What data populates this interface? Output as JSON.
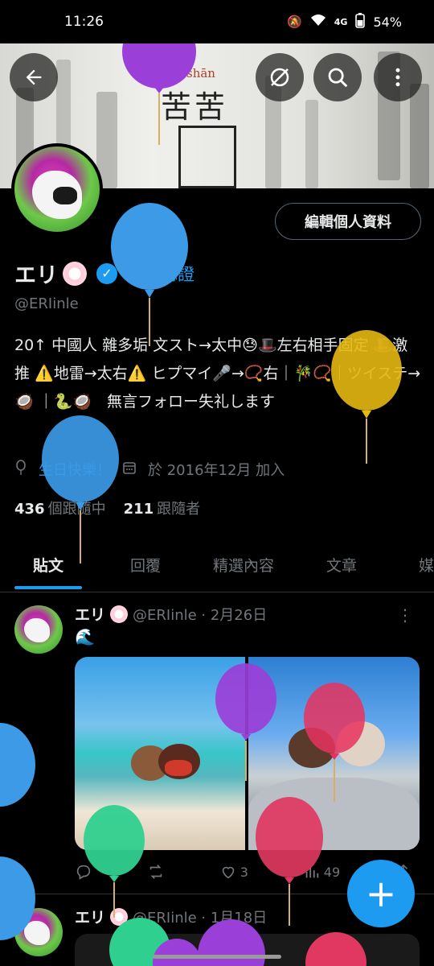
{
  "status": {
    "time": "11:26",
    "battery": "54%",
    "network": "4G"
  },
  "profile": {
    "name": "エリ",
    "verified_label": "獲得認證",
    "handle": "@ERIinle",
    "edit_label": "編輯個人資料",
    "bio": "20↑ 中國人 雜多垢 文スト→太中😓🎩左右相手固定 🎩激推 ⚠️地雷→太右⚠️ ヒプマイ🎤→📿右｜🎋📿｜ツイステ→ 🥥 ｜🐍🥥　無言フォロー失礼します",
    "birthday": "生日快樂！",
    "joined": "於 2016年12月 加入",
    "following_count": "436",
    "following_label": "個跟隨中",
    "followers_count": "211",
    "followers_label": "跟隨者"
  },
  "banner": {
    "pinyin": "shān",
    "chars": "苦苦"
  },
  "tabs": [
    {
      "label": "貼文",
      "active": true
    },
    {
      "label": "回覆",
      "active": false
    },
    {
      "label": "精選內容",
      "active": false
    },
    {
      "label": "文章",
      "active": false
    },
    {
      "label": "媒",
      "active": false
    }
  ],
  "posts": [
    {
      "name": "エリ",
      "meta": "@ERIinle · 2月26日",
      "text": "🌊",
      "likes": "3",
      "views": "49"
    },
    {
      "name": "エリ",
      "meta": "@ERIinle · 1月18日"
    }
  ],
  "icons": {
    "back": "arrow-left-icon",
    "incognito": "no-circle-icon",
    "search": "search-icon",
    "more": "more-vertical-icon",
    "compose": "plus-icon"
  },
  "colors": {
    "accent": "#1d9bf0",
    "background": "#000000",
    "text": "#e7e9ea",
    "muted": "#71767b"
  }
}
